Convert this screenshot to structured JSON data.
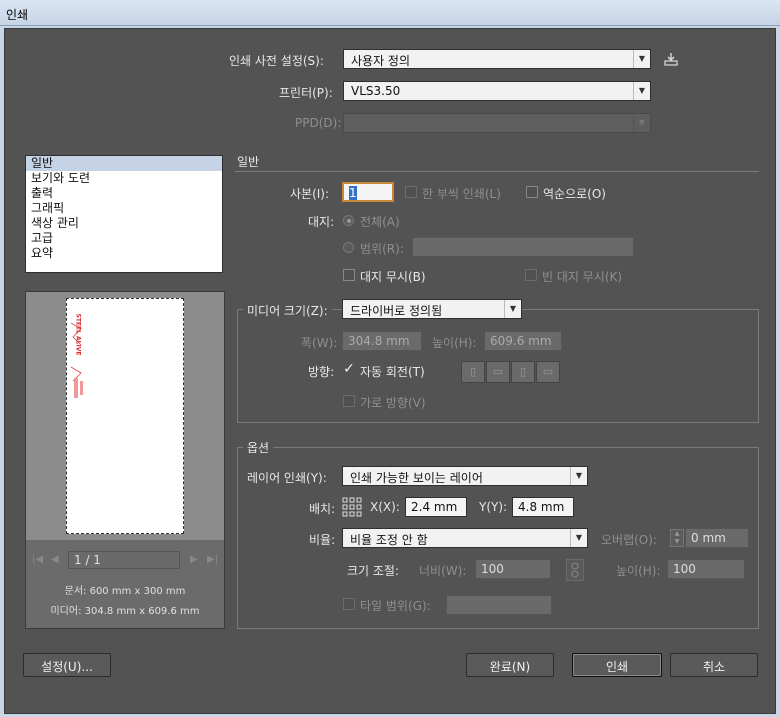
{
  "window": {
    "title": "인쇄"
  },
  "top": {
    "preset_label": "인쇄 사전 설정(S):",
    "preset_value": "사용자 정의",
    "printer_label": "프린터(P):",
    "printer_value": "VLS3.50",
    "ppd_label": "PPD(D):",
    "ppd_value": ""
  },
  "sidebar": {
    "items": [
      {
        "label": "일반"
      },
      {
        "label": "보기와 도련"
      },
      {
        "label": "출력"
      },
      {
        "label": "그래픽"
      },
      {
        "label": "색상 관리"
      },
      {
        "label": "고급"
      },
      {
        "label": "요약"
      }
    ]
  },
  "preview": {
    "page_indicator": "1 / 1",
    "document_label": "문서",
    "document_size": ": 600 mm x 300 mm",
    "media_label": "미디어",
    "media_size": ": 304.8 mm x 609.6 mm",
    "art_text": "STEEL ALIVE"
  },
  "general": {
    "section_title": "일반",
    "copies_label": "사본(I):",
    "copies_value": "1",
    "collate_label": "한 부씩 인쇄(L)",
    "reverse_label": "역순으로(O)",
    "pages_label": "대지:",
    "all_label": "전체(A)",
    "range_label": "범위(R):",
    "range_value": "",
    "ignore_artboards_label": "대지 무시(B)",
    "skip_blank_label": "빈 대지 무시(K)"
  },
  "media": {
    "size_label": "미디어 크기(Z):",
    "size_value": "드라이버로 정의됨",
    "width_label": "폭(W):",
    "width_value": "304.8 mm",
    "height_label": "높이(H):",
    "height_value": "609.6 mm",
    "orientation_label": "방향:",
    "auto_rotate_label": "자동 회전(T)",
    "auto_rotate_checked": true,
    "transverse_label": "가로 방향(V)"
  },
  "options": {
    "section_title": "옵션",
    "layers_label": "레이어 인쇄(Y):",
    "layers_value": "인쇄 가능한 보이는 레이어",
    "placement_label": "배치:",
    "x_label": "X(X):",
    "x_value": "2.4 mm",
    "y_label": "Y(Y):",
    "y_value": "4.8 mm",
    "scale_label": "비율:",
    "scale_value": "비율 조정 안 함",
    "overlap_label": "오버랩(O):",
    "overlap_value": "0 mm",
    "resize_label": "크기 조절:",
    "width_label": "너비(W):",
    "width_value": "100",
    "height_label": "높이(H):",
    "height_value": "100",
    "tile_label": "타일 범위(G):",
    "tile_value": ""
  },
  "buttons": {
    "setup": "설정(U)...",
    "done": "완료(N)",
    "print": "인쇄",
    "cancel": "취소"
  }
}
